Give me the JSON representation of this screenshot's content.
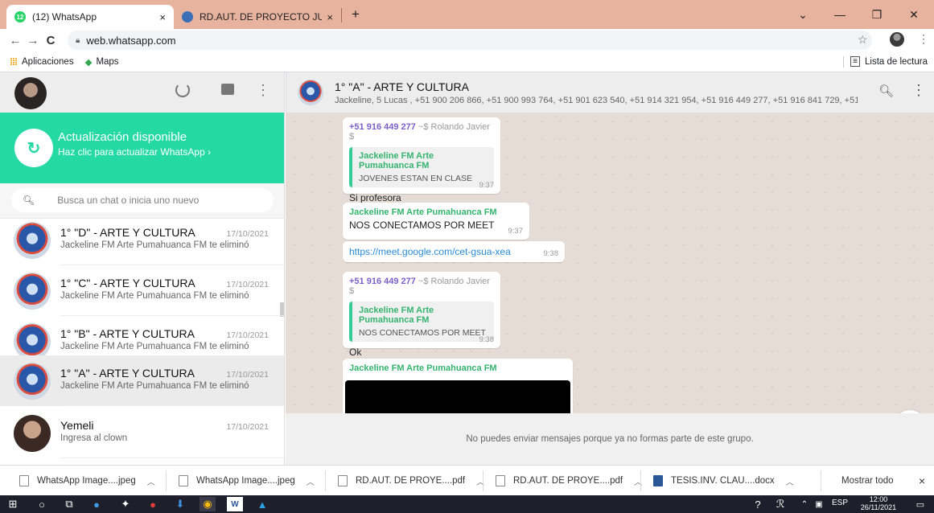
{
  "browser": {
    "tabs": [
      {
        "title": "(12) WhatsApp",
        "badge": "12",
        "close": "×"
      },
      {
        "title": "RD.AUT. DE PROYECTO JUDITH C",
        "close": "×"
      }
    ],
    "new_tab": "+",
    "url": "web.whatsapp.com",
    "bookmarks": {
      "apps": "Aplicaciones",
      "maps": "Maps",
      "reading_list": "Lista de lectura"
    }
  },
  "whatsapp": {
    "update": {
      "title": "Actualización disponible",
      "subtitle": "Haz clic para actualizar WhatsApp ›"
    },
    "search_placeholder": "Busca un chat o inicia uno nuevo",
    "chats": [
      {
        "name": "1° \"D\" - ARTE Y CULTURA",
        "date": "17/10/2021",
        "preview": "Jackeline FM Arte Pumahuanca FM te eliminó"
      },
      {
        "name": "1° \"C\" - ARTE Y CULTURA",
        "date": "17/10/2021",
        "preview": "Jackeline FM Arte Pumahuanca FM te eliminó"
      },
      {
        "name": "1° \"B\" - ARTE Y CULTURA",
        "date": "17/10/2021",
        "preview": "Jackeline FM Arte Pumahuanca FM te eliminó"
      },
      {
        "name": "1° \"A\" - ARTE Y CULTURA",
        "date": "17/10/2021",
        "preview": "Jackeline FM Arte Pumahuanca FM te eliminó"
      },
      {
        "name": "Yemeli",
        "date": "17/10/2021",
        "preview": "Ingresa al clown"
      }
    ],
    "conversation": {
      "title": "1° \"A\" - ARTE Y CULTURA",
      "members": "Jackeline, 5 Lucas , +51 900 206 866, +51 900 993 764, +51 901 623 540, +51 914 321 954, +51 916 449 277, +51 916 841 729, +51 ...",
      "messages": [
        {
          "phone": "+51 916 449 277",
          "alias": "~$ Rolando Javier $",
          "quote_name": "Jackeline FM Arte Pumahuanca FM",
          "quote_text": "JOVENES ESTAN EN CLASE",
          "text": "Si profesora",
          "time": "9:37"
        },
        {
          "sender": "Jackeline FM Arte Pumahuanca FM",
          "text": "NOS CONECTAMOS POR MEET",
          "time": "9:37"
        },
        {
          "text": "https://meet.google.com/cet-gsua-xea",
          "time": "9:38"
        },
        {
          "phone": "+51 916 449 277",
          "alias": "~$ Rolando Javier $",
          "quote_name": "Jackeline FM Arte Pumahuanca FM",
          "quote_text": "NOS CONECTAMOS POR MEET",
          "text": "Ok",
          "time": "9:38"
        },
        {
          "sender": "Jackeline FM Arte Pumahuanca FM"
        }
      ],
      "footer": "No puedes enviar mensajes porque ya no formas parte de este grupo."
    }
  },
  "downloads": {
    "items": [
      "WhatsApp Image....jpeg",
      "WhatsApp Image....jpeg",
      "RD.AUT. DE PROYE....pdf",
      "RD.AUT. DE PROYE....pdf",
      "TESIS.INV. CLAU....docx"
    ],
    "show_all": "Mostrar todo",
    "close": "×"
  },
  "taskbar": {
    "lang": "ESP",
    "time": "12:00",
    "date": "26/11/2021"
  },
  "colors": {
    "accent": "#25d9a5",
    "tab_strip": "#e8b39e",
    "chat_bg": "#e5ddd5"
  }
}
